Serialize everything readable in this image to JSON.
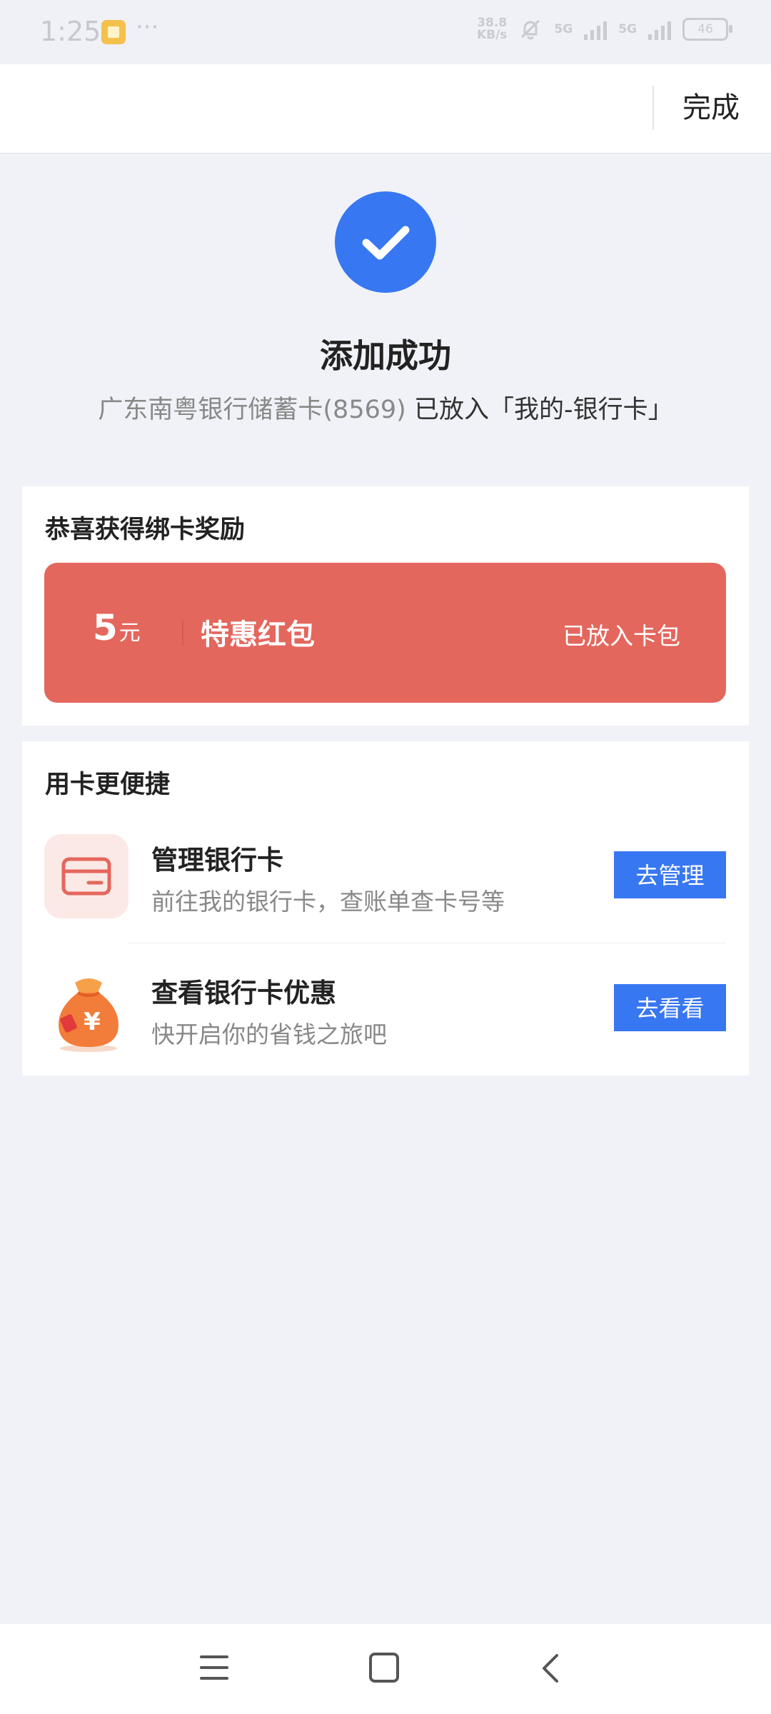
{
  "status_bar": {
    "time": "1:25",
    "dots": "···",
    "net_speed_value": "38.8",
    "net_speed_unit": "KB/s",
    "signal1": "5G",
    "signal2": "5G",
    "battery": "46"
  },
  "header": {
    "done_label": "完成"
  },
  "success": {
    "icon": "check-icon",
    "title": "添加成功",
    "card_name": "广东南粤银行储蓄卡(8569)",
    "destination": "已放入「我的-银行卡」"
  },
  "reward": {
    "section_title": "恭喜获得绑卡奖励",
    "amount": "5",
    "unit": "元",
    "name": "特惠红包",
    "status": "已放入卡包",
    "color": "#e4675d"
  },
  "convenience": {
    "section_title": "用卡更便捷",
    "items": [
      {
        "icon": "bank-card-icon",
        "title": "管理银行卡",
        "desc": "前往我的银行卡，查账单查卡号等",
        "button": "去管理"
      },
      {
        "icon": "money-bag-icon",
        "title": "查看银行卡优惠",
        "desc": "快开启你的省钱之旅吧",
        "button": "去看看"
      }
    ]
  },
  "accent_color": "#3877f2"
}
